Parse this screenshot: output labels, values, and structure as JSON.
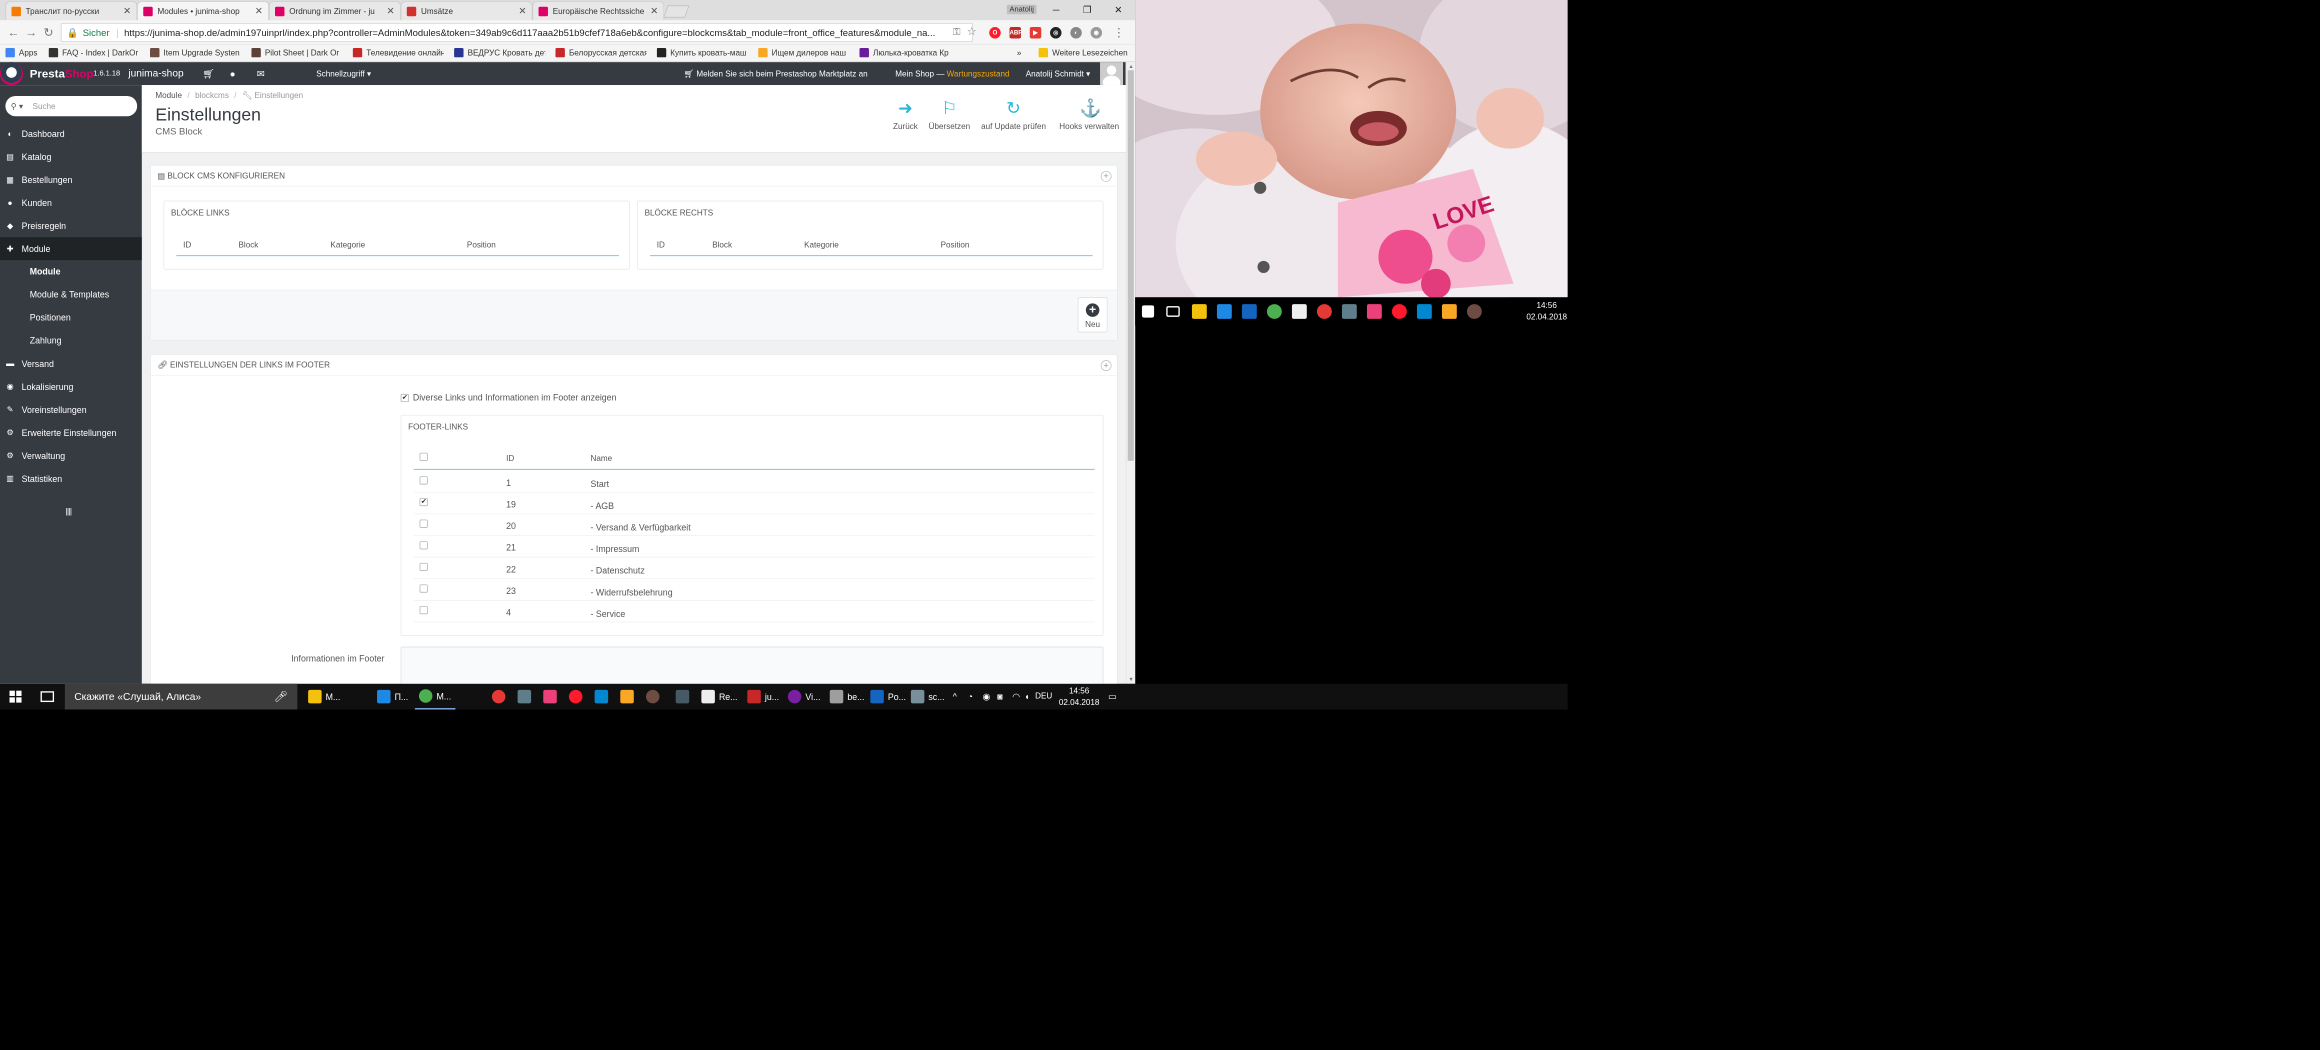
{
  "browser": {
    "tabs": [
      {
        "title": "Транслит по-русски",
        "color": "#f57c00"
      },
      {
        "title": "Modules • junima-shop",
        "color": "#df0067"
      },
      {
        "title": "Ordnung im Zimmer - ju",
        "color": "#df0067"
      },
      {
        "title": "Umsätze",
        "color": "#d32f2f"
      },
      {
        "title": "Europäische Rechtssiche",
        "color": "#df0067"
      }
    ],
    "window_user": "Anatolij",
    "secure_label": "Sicher",
    "url": "https://junima-shop.de/admin197uinprl/index.php?controller=AdminModules&token=349ab9c6d117aaa2b51b9cfef718a6eb&configure=blockcms&tab_module=front_office_features&module_na...",
    "bookmarks": [
      {
        "label": "Apps",
        "color": "#4285f4"
      },
      {
        "label": "FAQ - Index | DarkOr",
        "color": "#333333"
      },
      {
        "label": "Item Upgrade Systen",
        "color": "#6d4c41"
      },
      {
        "label": "Pilot Sheet | Dark Or",
        "color": "#5d4037"
      },
      {
        "label": "Телевидение онлайн",
        "color": "#c62828"
      },
      {
        "label": "ВЕДРУС Кровать дет",
        "color": "#283593"
      },
      {
        "label": "Белорусская детская",
        "color": "#c62828"
      },
      {
        "label": "Купить кровать-маш",
        "color": "#222222"
      },
      {
        "label": "Ищем дилеров наш",
        "color": "#f9a825"
      },
      {
        "label": "Люлька-кроватка Кр",
        "color": "#6a1b9a"
      }
    ],
    "bookmarks_more": "»",
    "other_bookmarks": "Weitere Lesezeichen"
  },
  "ps": {
    "brand_a": "Presta",
    "brand_b": "Shop",
    "version": "1.6.1.18",
    "shop_name": "junima-shop",
    "quick_access": "Schnellzugriff ▾",
    "marketplace": "Melden Sie sich beim Prestashop Marktplatz an",
    "my_shop": "Mein Shop — ",
    "maintenance": "Wartungszustand",
    "user": "Anatolij Schmidt ▾",
    "search_placeholder": "Suche",
    "nav": [
      {
        "label": "Dashboard",
        "icon": "dashboard-icon",
        "glyph": "◐"
      },
      {
        "label": "Katalog",
        "icon": "catalog-icon",
        "glyph": "▤"
      },
      {
        "label": "Bestellungen",
        "icon": "orders-icon",
        "glyph": "▦"
      },
      {
        "label": "Kunden",
        "icon": "customers-icon",
        "glyph": "●"
      },
      {
        "label": "Preisregeln",
        "icon": "price-rules-icon",
        "glyph": "◆"
      },
      {
        "label": "Module",
        "icon": "modules-icon",
        "glyph": "✚"
      },
      {
        "label": "Versand",
        "icon": "shipping-icon",
        "glyph": "▬"
      },
      {
        "label": "Lokalisierung",
        "icon": "localization-icon",
        "glyph": "◉"
      },
      {
        "label": "Voreinstellungen",
        "icon": "preferences-icon",
        "glyph": "✎"
      },
      {
        "label": "Erweiterte Einstellungen",
        "icon": "advanced-settings-icon",
        "glyph": "⚙"
      },
      {
        "label": "Verwaltung",
        "icon": "administration-icon",
        "glyph": "⚙"
      },
      {
        "label": "Statistiken",
        "icon": "stats-icon",
        "glyph": "▥"
      }
    ],
    "module_sub": [
      "Module",
      "Module & Templates",
      "Positionen",
      "Zahlung"
    ],
    "breadcrumb": [
      "Module",
      "blockcms",
      "Einstellungen"
    ],
    "page_title": "Einstellungen",
    "page_subtitle": "CMS Block",
    "toolbar": [
      {
        "label": "Zurück",
        "icon": "back-icon"
      },
      {
        "label": "Übersetzen",
        "icon": "flag-icon"
      },
      {
        "label": "auf Update prüfen",
        "icon": "refresh-icon"
      },
      {
        "label": "Hooks verwalten",
        "icon": "anchor-icon"
      }
    ],
    "panel1_title": "BLOCK CMS KONFIGURIEREN",
    "left_blocks_title": "BLÖCKE LINKS",
    "right_blocks_title": "BLÖCKE RECHTS",
    "block_columns": [
      "ID",
      "Block",
      "Kategorie",
      "Position"
    ],
    "new_label": "Neu",
    "panel2_title": "EINSTELLUNGEN DER LINKS IM FOOTER",
    "show_footer_label": "Diverse Links und Informationen im Footer anzeigen",
    "footer_links_title": "FOOTER-LINKS",
    "footer_columns": [
      "ID",
      "Name"
    ],
    "footer_rows": [
      {
        "id": "1",
        "name": "Start",
        "checked": false
      },
      {
        "id": "19",
        "name": "- AGB",
        "checked": true
      },
      {
        "id": "20",
        "name": "- Versand & Verfügbarkeit",
        "checked": false
      },
      {
        "id": "21",
        "name": "- Impressum",
        "checked": false
      },
      {
        "id": "22",
        "name": "- Datenschutz",
        "checked": false
      },
      {
        "id": "23",
        "name": "- Widerrufsbelehrung",
        "checked": false
      },
      {
        "id": "4",
        "name": "- Service",
        "checked": false
      }
    ],
    "footer_info_label": "Informationen im Footer"
  },
  "photo_caption": "LOVE",
  "taskbar": {
    "cortana": "Скажите «Слушай, Алиса»",
    "apps": [
      "M...",
      "П...",
      "M...",
      "Re...",
      "ju...",
      "Vi...",
      "be...",
      "Po...",
      "sc..."
    ],
    "lang": "DEU",
    "time": "14:56",
    "date": "02.04.2018"
  },
  "colors": {
    "accent": "#25b9d7",
    "sidebar": "#363a41",
    "brand_pink": "#df0067",
    "warn": "#f7a900"
  }
}
